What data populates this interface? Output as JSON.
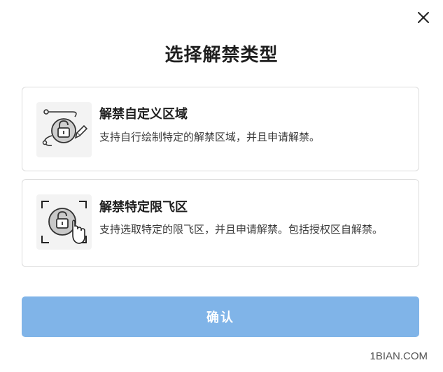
{
  "dialog": {
    "title": "选择解禁类型",
    "close_icon": "close-icon"
  },
  "options": [
    {
      "icon": "draw-area-unlock-icon",
      "title": "解禁自定义区域",
      "description": "支持自行绘制特定的解禁区域，并且申请解禁。"
    },
    {
      "icon": "select-zone-unlock-icon",
      "title": "解禁特定限飞区",
      "description": "支持选取特定的限飞区，并且申请解禁。包括授权区自解禁。"
    }
  ],
  "confirm_label": "确认",
  "watermark": "1BIAN.COM",
  "colors": {
    "primary_button": "#80b4e8",
    "card_border": "#dcdcdc",
    "icon_background": "#f3f3f3"
  }
}
